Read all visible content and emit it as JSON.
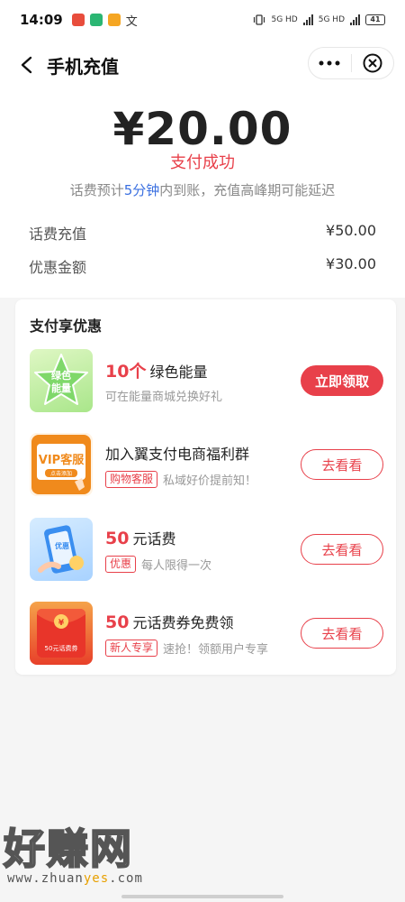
{
  "status_bar": {
    "time": "14:09",
    "network_1": "5G HD",
    "network_2": "5G HD",
    "battery": "41",
    "app_colors": [
      "#e84d3c",
      "#2bb673",
      "#f5a623"
    ],
    "translate_glyph": "文"
  },
  "nav": {
    "title": "手机充值",
    "back_icon": "chevron-left-icon",
    "more_icon": "more-dots-icon",
    "close_icon": "close-circle-icon"
  },
  "payment": {
    "amount": "¥20.00",
    "status": "支付成功",
    "notice_prefix": "话费预计",
    "notice_highlight": "5分钟",
    "notice_suffix": "内到账，充值高峰期可能延迟",
    "rows": [
      {
        "label": "话费充值",
        "value": "¥50.00"
      },
      {
        "label": "优惠金额",
        "value": "¥30.00"
      }
    ]
  },
  "offers_card": {
    "title": "支付享优惠",
    "offers": [
      {
        "thumb_text": "绿色\n能量",
        "thumb_line1": "绿色",
        "thumb_line2": "能量",
        "highlight": "10个",
        "title": "绿色能量",
        "tag": "",
        "subtitle": "可在能量商城兑换好礼",
        "button": "立即领取"
      },
      {
        "thumb_line1": "VIP客服",
        "thumb_line2": "点击添加",
        "highlight": "",
        "title": "加入翼支付电商福利群",
        "tag": "购物客服",
        "subtitle": "私域好价提前知！",
        "button": "去看看"
      },
      {
        "thumb_line1": "优惠",
        "highlight": "50",
        "title": "元话费",
        "tag": "优惠",
        "subtitle": "每人限得一次",
        "button": "去看看"
      },
      {
        "thumb_line1": "¥",
        "thumb_line2": "50元话费券",
        "highlight": "50",
        "title": "元话费券免费领",
        "tag": "新人专享",
        "subtitle": "速抢！领额用户专享",
        "button": "去看看"
      }
    ]
  },
  "watermark": {
    "main": "好赚网",
    "url_prefix": "www.zhuan",
    "url_accent": "yes",
    "url_suffix": ".com"
  },
  "colors": {
    "accent": "#e8404a",
    "link": "#3a6fe0"
  }
}
